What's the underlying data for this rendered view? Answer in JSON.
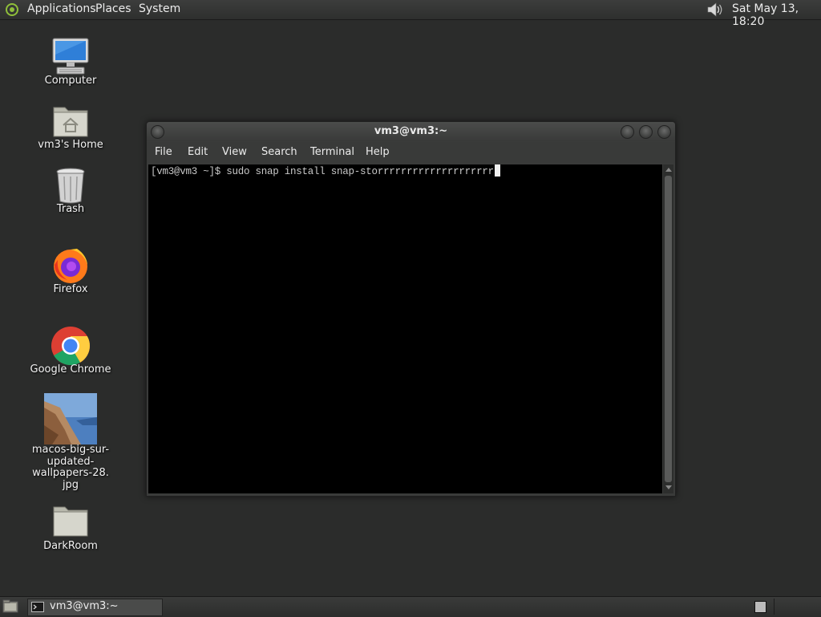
{
  "top_panel": {
    "menus": [
      "Applications",
      "Places",
      "System"
    ],
    "clock": "Sat May 13, 18:20"
  },
  "desktop": {
    "icons": [
      {
        "label": "Computer",
        "icon": "computer-icon"
      },
      {
        "label": "vm3's Home",
        "icon": "home-folder-icon"
      },
      {
        "label": "Trash",
        "icon": "trash-icon"
      },
      {
        "label": "Firefox",
        "icon": "firefox-icon"
      },
      {
        "label": "Google Chrome",
        "icon": "chrome-icon"
      },
      {
        "label_lines": [
          "macos-big-sur-",
          "updated-wallpapers-28.",
          "jpg"
        ],
        "icon": "image-file-icon"
      },
      {
        "label": "DarkRoom",
        "icon": "folder-icon"
      }
    ]
  },
  "terminal": {
    "title": "vm3@vm3:~",
    "menu": [
      "File",
      "Edit",
      "View",
      "Search",
      "Terminal",
      "Help"
    ],
    "prompt": "[vm3@vm3 ~]$ ",
    "command": "sudo snap install snap-storrrrrrrrrrrrrrrrrrrr"
  },
  "bottom_panel": {
    "task_label": "vm3@vm3:~"
  },
  "colors": {
    "desktop_bg": "#2b2c2b",
    "terminal_bg": "#000000",
    "panel_bg": "#333433"
  }
}
